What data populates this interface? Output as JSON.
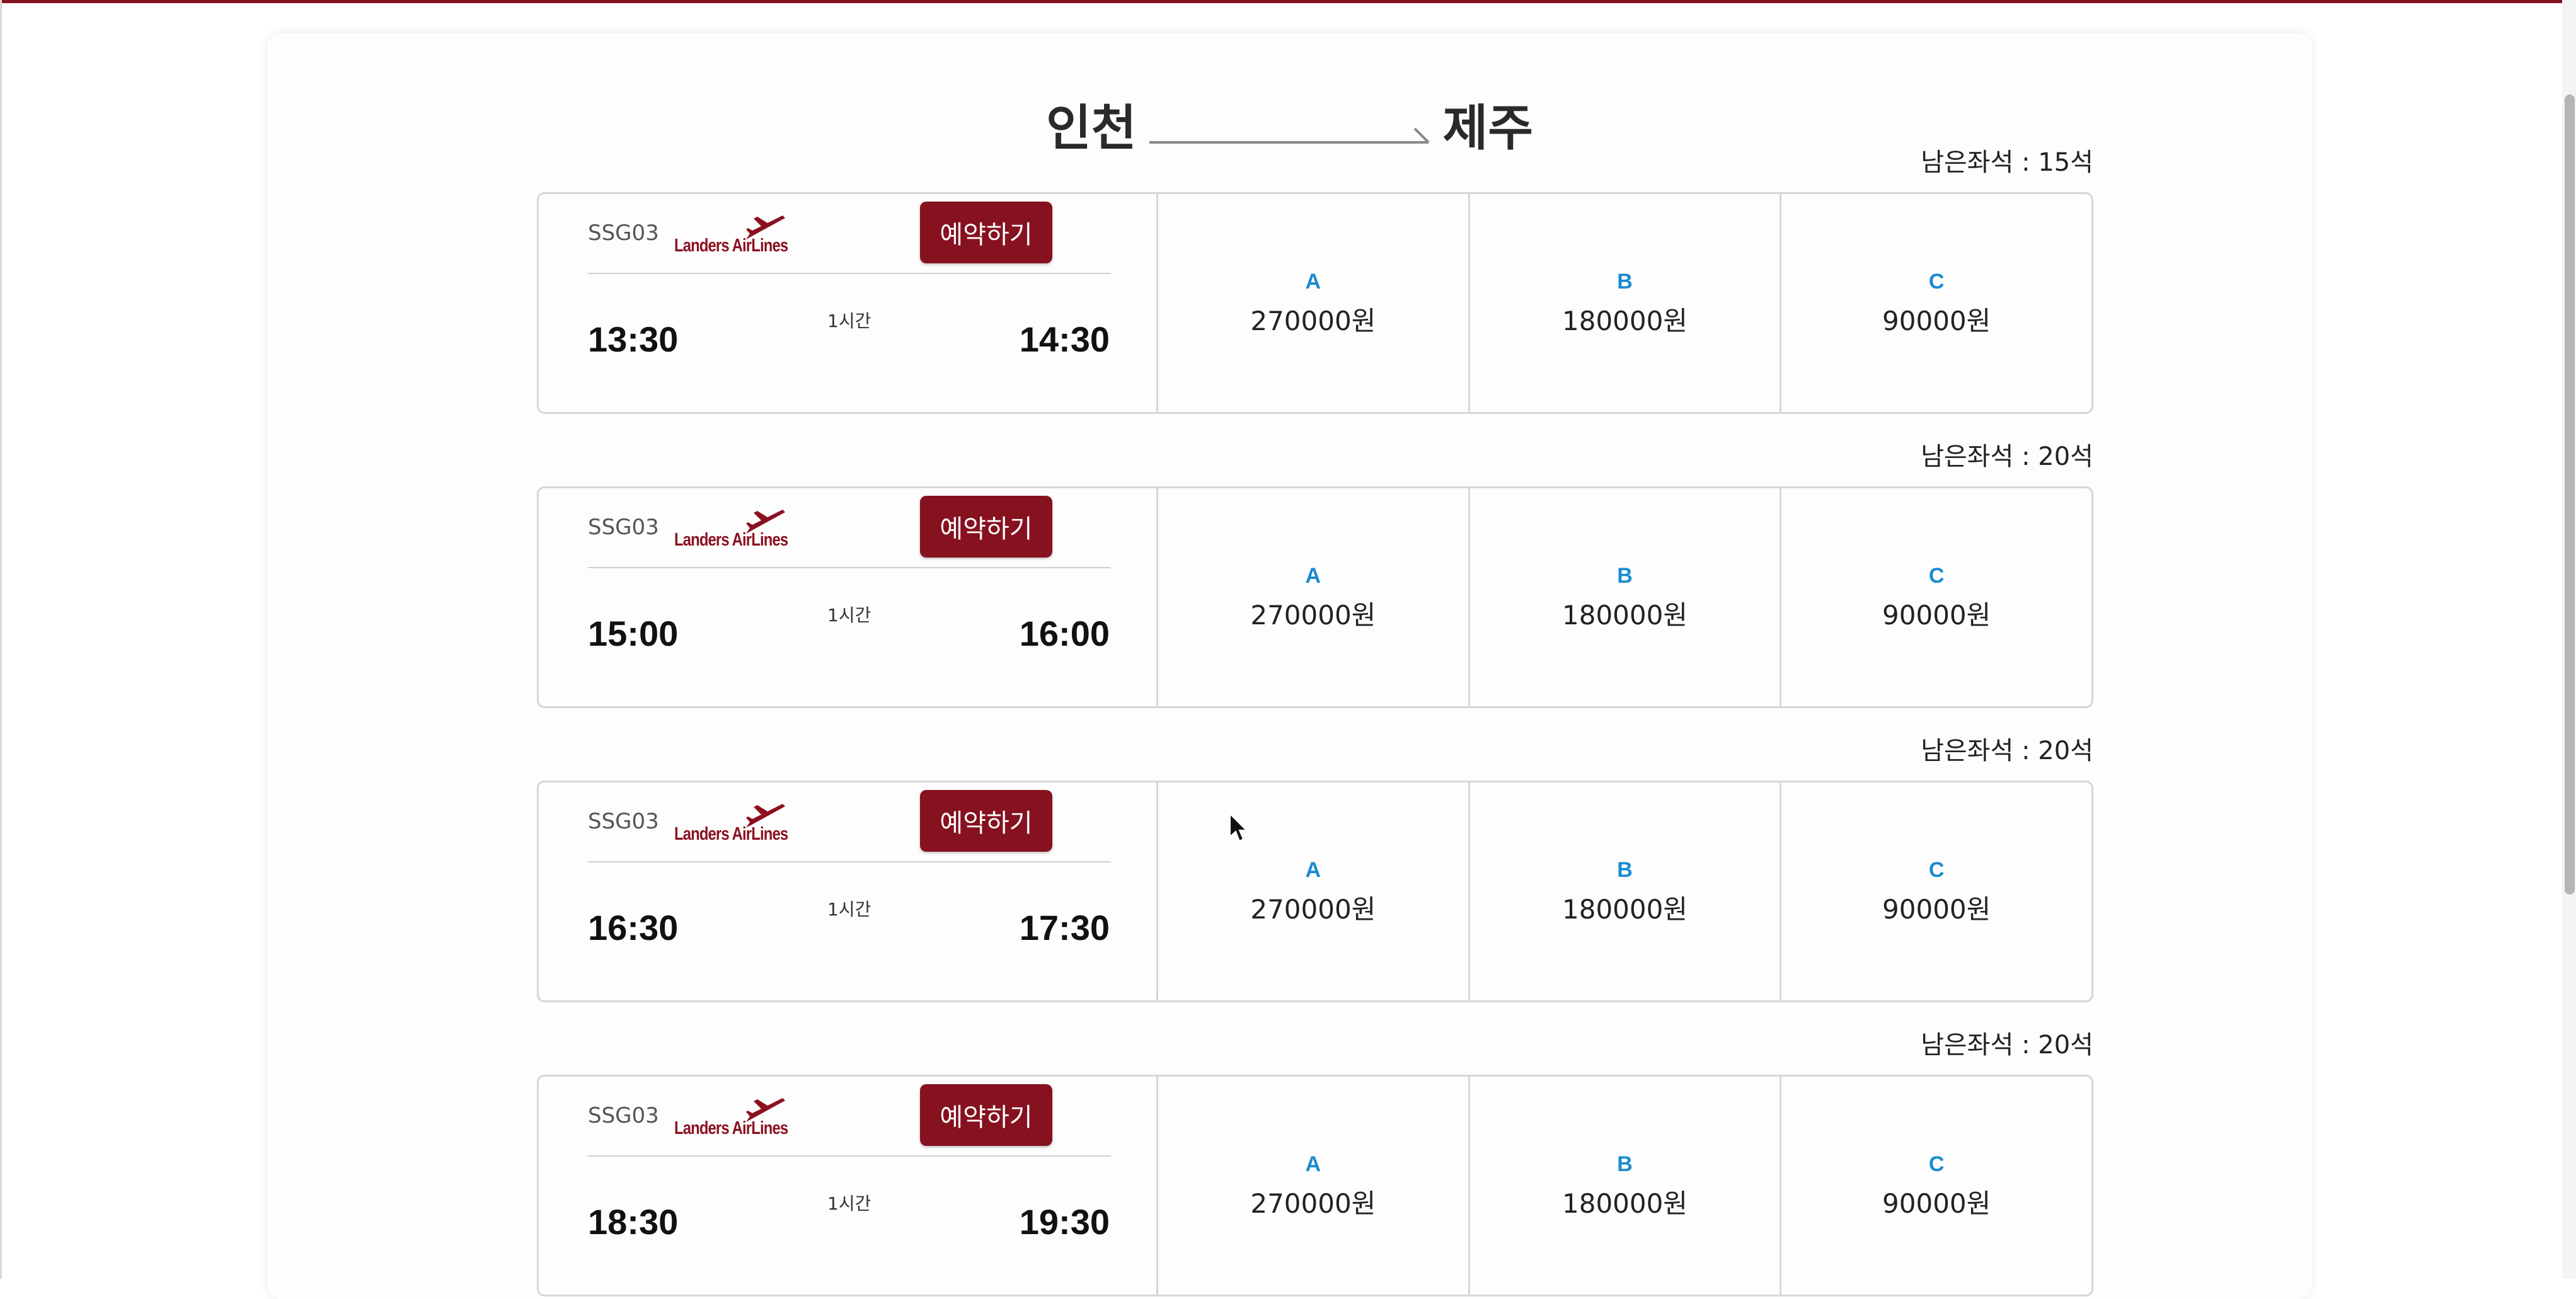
{
  "route": {
    "from": "인천",
    "to": "제주"
  },
  "flights": [
    {
      "seats_left": "남은좌석 : 15석",
      "code": "SSG03",
      "airline": "Landers AirLines",
      "book_label": "예약하기",
      "departure": "13:30",
      "arrival": "14:30",
      "duration": "1시간",
      "fares": [
        {
          "grade": "A",
          "price": "270000원"
        },
        {
          "grade": "B",
          "price": "180000원"
        },
        {
          "grade": "C",
          "price": "90000원"
        }
      ]
    },
    {
      "seats_left": "남은좌석 : 20석",
      "code": "SSG03",
      "airline": "Landers AirLines",
      "book_label": "예약하기",
      "departure": "15:00",
      "arrival": "16:00",
      "duration": "1시간",
      "fares": [
        {
          "grade": "A",
          "price": "270000원"
        },
        {
          "grade": "B",
          "price": "180000원"
        },
        {
          "grade": "C",
          "price": "90000원"
        }
      ]
    },
    {
      "seats_left": "남은좌석 : 20석",
      "code": "SSG03",
      "airline": "Landers AirLines",
      "book_label": "예약하기",
      "departure": "16:30",
      "arrival": "17:30",
      "duration": "1시간",
      "fares": [
        {
          "grade": "A",
          "price": "270000원"
        },
        {
          "grade": "B",
          "price": "180000원"
        },
        {
          "grade": "C",
          "price": "90000원"
        }
      ]
    },
    {
      "seats_left": "남은좌석 : 20석",
      "code": "SSG03",
      "airline": "Landers AirLines",
      "book_label": "예약하기",
      "departure": "18:30",
      "arrival": "19:30",
      "duration": "1시간",
      "fares": [
        {
          "grade": "A",
          "price": "270000원"
        },
        {
          "grade": "B",
          "price": "180000원"
        },
        {
          "grade": "C",
          "price": "90000원"
        }
      ]
    }
  ],
  "colors": {
    "brand": "#86111f",
    "grade": "#1a8bd0"
  },
  "icons": {
    "airline_logo": "airplane-icon",
    "route_arrow": "arrow-right-icon",
    "cursor": "mouse-pointer-icon"
  }
}
